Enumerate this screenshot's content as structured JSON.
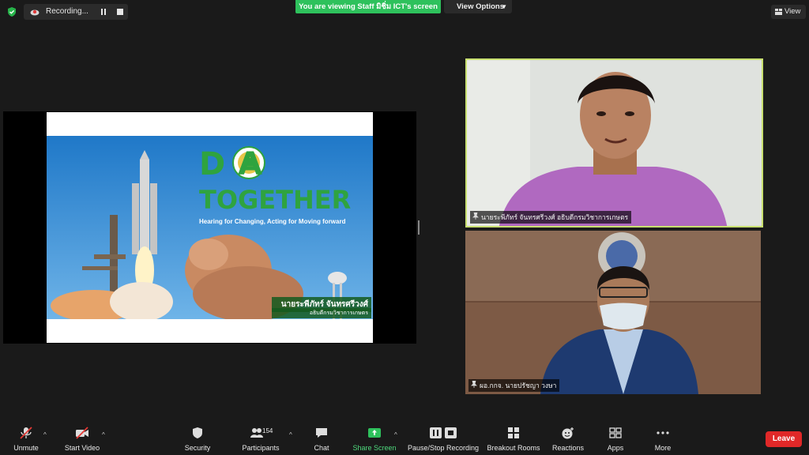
{
  "top_bar": {
    "recording_label": "Recording...",
    "banner_text": "You are viewing Staff มิชิ่ม ICT's screen",
    "view_options_label": "View Options",
    "view_label": "View"
  },
  "shared_screen": {
    "slide_title": "D   A",
    "slide_subtitle": "TOGETHER",
    "slide_tagline": "Hearing for Changing, Acting for Moving forward",
    "slide_name": "นายระพีภัทร์ จันทรศรีวงศ์",
    "slide_role": "อธิบดีกรมวิชาการเกษตร"
  },
  "participants": [
    {
      "name": "นายระพีภัทร์ จันทรศรีวงศ์ อธิบดีกรมวิชาการเกษตร"
    },
    {
      "name": "ผอ.กกจ. นายปรัชญา วงษา"
    }
  ],
  "toolbar": {
    "unmute": "Unmute",
    "start_video": "Start Video",
    "security": "Security",
    "participants": "Participants",
    "participant_count": "154",
    "chat": "Chat",
    "share_screen": "Share Screen",
    "pause_stop_recording": "Pause/Stop Recording",
    "breakout_rooms": "Breakout Rooms",
    "reactions": "Reactions",
    "apps": "Apps",
    "more": "More",
    "leave": "Leave"
  },
  "colors": {
    "accent_green": "#2ec15c",
    "leave_red": "#e02828",
    "active_speaker_border": "#c8e070"
  }
}
